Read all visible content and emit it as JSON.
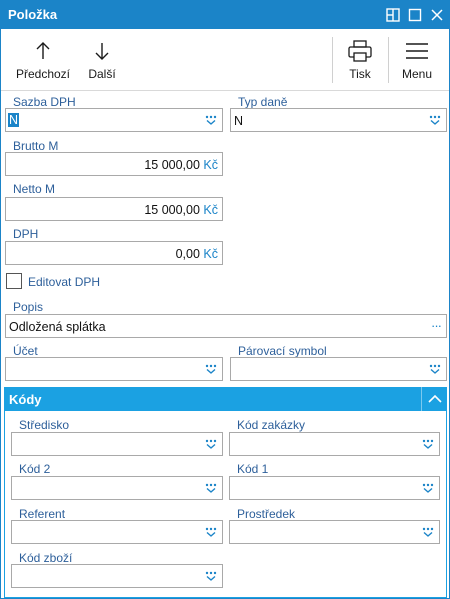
{
  "window": {
    "title": "Položka"
  },
  "toolbar": {
    "prev_label": "Předchozí",
    "next_label": "Další",
    "print_label": "Tisk",
    "menu_label": "Menu"
  },
  "form": {
    "sazba_dph": {
      "label": "Sazba DPH",
      "value": "N"
    },
    "typ_dane": {
      "label": "Typ daně",
      "value": "N"
    },
    "brutto": {
      "label": "Brutto M",
      "value": "15 000,00",
      "currency": "Kč"
    },
    "netto": {
      "label": "Netto M",
      "value": "15 000,00",
      "currency": "Kč"
    },
    "dph": {
      "label": "DPH",
      "value": "0,00",
      "currency": "Kč"
    },
    "editovat_dph": {
      "label": "Editovat DPH",
      "checked": false
    },
    "popis": {
      "label": "Popis",
      "value": "Odložená splátka",
      "more": "···"
    },
    "ucet": {
      "label": "Účet",
      "value": ""
    },
    "parovaci_symbol": {
      "label": "Párovací symbol",
      "value": ""
    }
  },
  "kody": {
    "title": "Kódy",
    "stredisko": {
      "label": "Středisko",
      "value": ""
    },
    "kod_zakazky": {
      "label": "Kód zakázky",
      "value": ""
    },
    "kod_2": {
      "label": "Kód 2",
      "value": ""
    },
    "kod_1": {
      "label": "Kód 1",
      "value": ""
    },
    "referent": {
      "label": "Referent",
      "value": ""
    },
    "prostredek": {
      "label": "Prostředek",
      "value": ""
    },
    "kod_zbozi": {
      "label": "Kód zboží",
      "value": ""
    }
  },
  "colors": {
    "accent": "#1b84c8",
    "section": "#1ba1e2",
    "label": "#2d5f9a"
  }
}
